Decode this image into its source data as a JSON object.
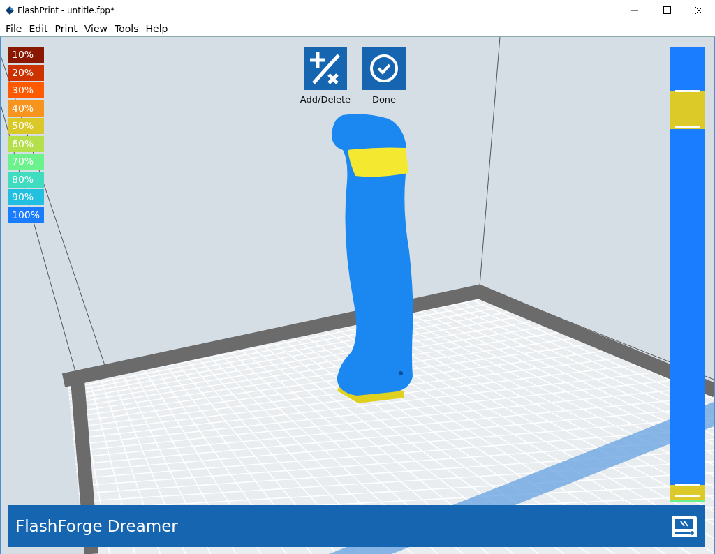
{
  "window": {
    "title": "FlashPrint - untitle.fpp*"
  },
  "menu": [
    "File",
    "Edit",
    "Print",
    "View",
    "Tools",
    "Help"
  ],
  "legend": [
    {
      "label": "10%",
      "color": "#8a1800"
    },
    {
      "label": "20%",
      "color": "#cc3300"
    },
    {
      "label": "30%",
      "color": "#ff5a00"
    },
    {
      "label": "40%",
      "color": "#f7941d"
    },
    {
      "label": "50%",
      "color": "#d9c828"
    },
    {
      "label": "60%",
      "color": "#b5e04c"
    },
    {
      "label": "70%",
      "color": "#6cf28c"
    },
    {
      "label": "80%",
      "color": "#40dcc0"
    },
    {
      "label": "90%",
      "color": "#22c0e0"
    },
    {
      "label": "100%",
      "color": "#1a7cff"
    }
  ],
  "toolbar": [
    {
      "label": "Add/Delete",
      "kind": "add-delete"
    },
    {
      "label": "Done",
      "kind": "done"
    }
  ],
  "printer_bar": {
    "name": "FlashForge Dreamer"
  }
}
